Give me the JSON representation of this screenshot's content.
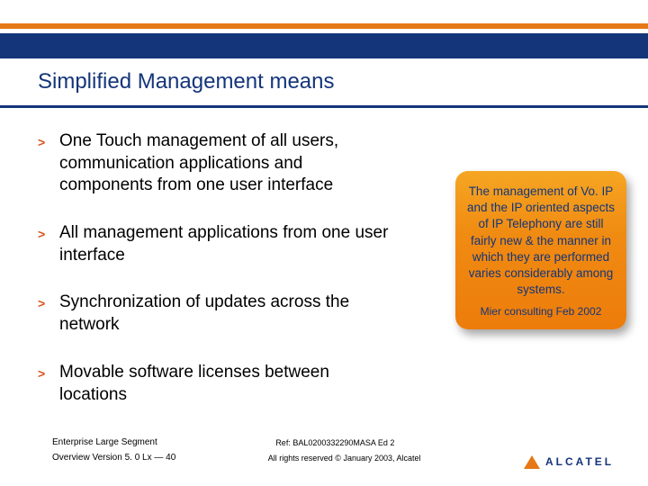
{
  "header": {
    "title": "Simplified Management means"
  },
  "bullets": [
    "One Touch management of all users, communication applications and components from one user interface",
    "All management applications from one user interface",
    "Synchronization of updates across the network",
    "Movable software licenses between locations"
  ],
  "callout": {
    "body": "The management of Vo. IP and the IP oriented aspects of IP Telephony are still fairly new & the manner in which they are performed varies considerably among systems.",
    "credit": "Mier consulting Feb 2002"
  },
  "footer": {
    "segment": "Enterprise Large Segment",
    "ref": "Ref: BAL0200332290MASA Ed 2",
    "version": "Overview Version 5. 0 Lx  — 40",
    "rights": "All rights reserved © January 2003, Alcatel",
    "logo_text": "ALCATEL"
  }
}
